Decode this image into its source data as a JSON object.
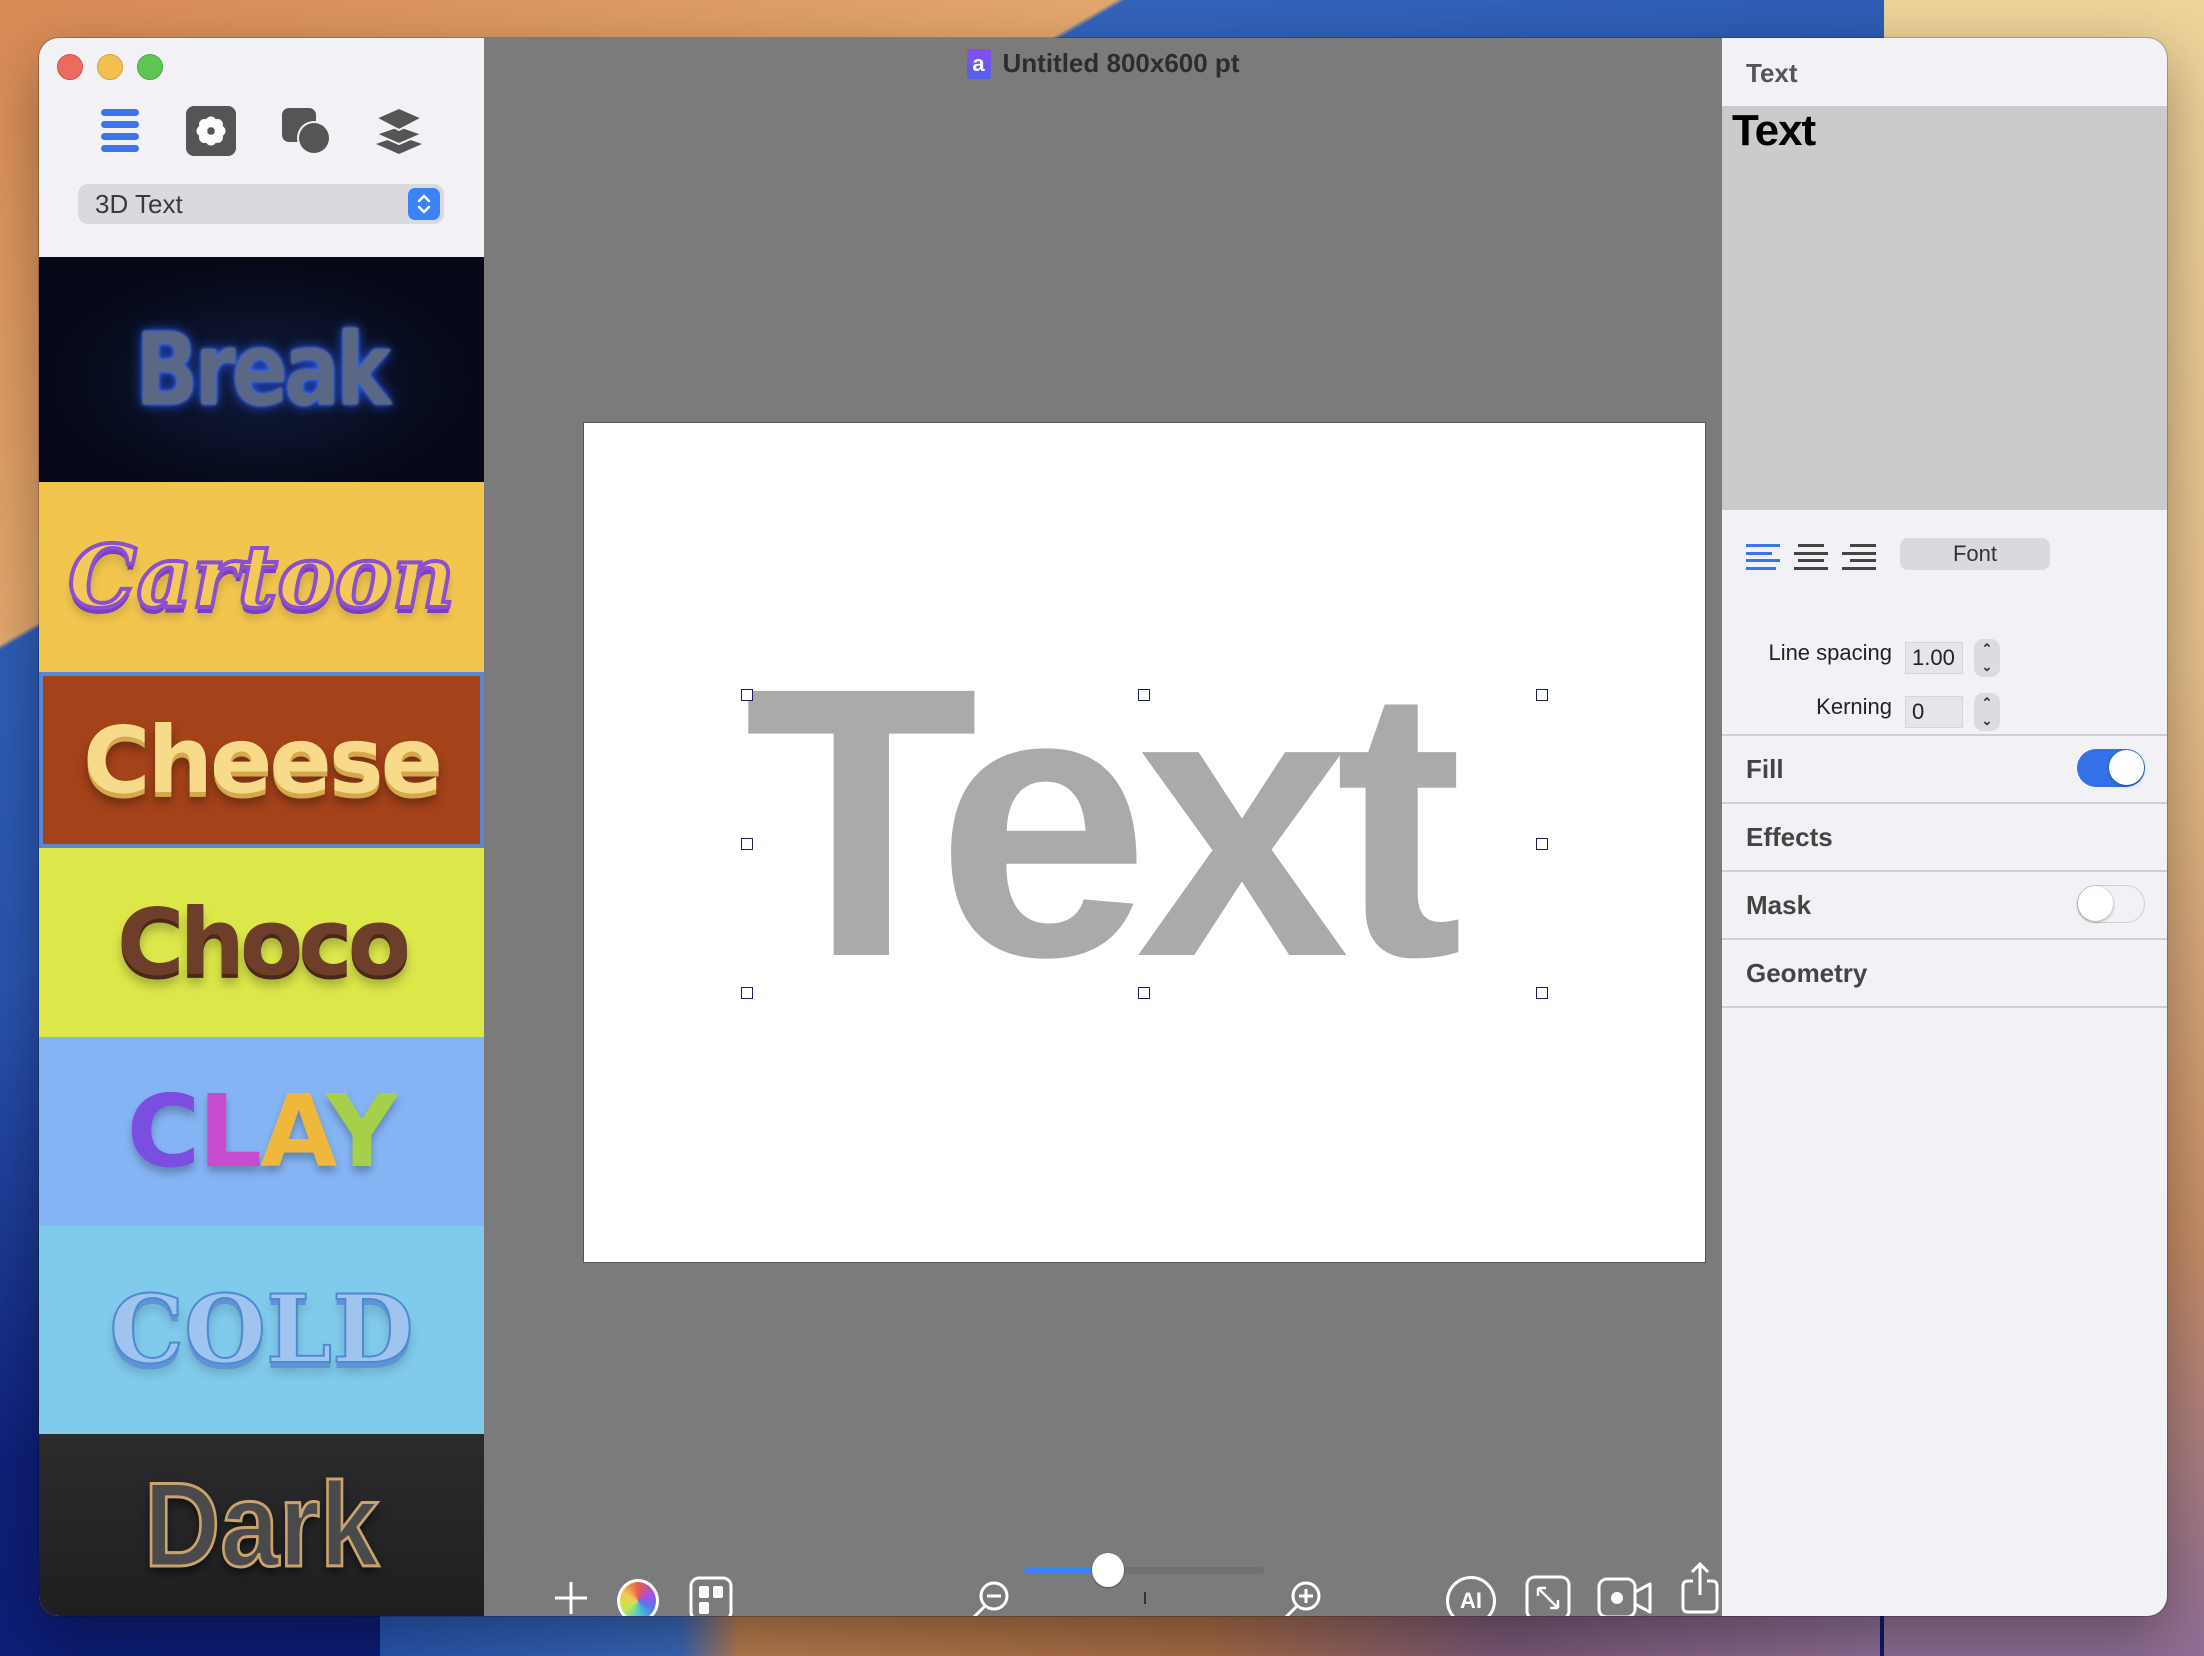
{
  "window": {
    "title": "Untitled 800x600 pt",
    "doc_icon_letter": "a"
  },
  "sidebar": {
    "tools": [
      {
        "name": "list",
        "icon": "list-icon",
        "active": true
      },
      {
        "name": "effects",
        "icon": "flower-gear-icon",
        "active": false
      },
      {
        "name": "shapes",
        "icon": "shapes-icon",
        "active": false
      },
      {
        "name": "layers",
        "icon": "layers-icon",
        "active": false
      }
    ],
    "category_select": {
      "value": "3D Text"
    },
    "styles": [
      {
        "label": "Break",
        "background": "#050816",
        "selected": false
      },
      {
        "label": "Cartoon",
        "background": "#f2c64e",
        "selected": false
      },
      {
        "label": "Cheese",
        "background": "#a4421a",
        "selected": true
      },
      {
        "label": "Choco",
        "background": "#dce74a",
        "selected": false
      },
      {
        "label": "CLAY",
        "background": "#85b4f4",
        "selected": false,
        "letter_colors": [
          "#7a4fe0",
          "#c94bd0",
          "#f0b83a",
          "#a6cf4a"
        ]
      },
      {
        "label": "COLD",
        "background": "#80caec",
        "selected": false
      },
      {
        "label": "Dark",
        "background": "#262628",
        "selected": false
      }
    ]
  },
  "canvas": {
    "text": "Text",
    "text_color": "#aaaaaa",
    "selected": true
  },
  "bottom_toolbar": {
    "add": "plus-icon",
    "color": "color-wheel-icon",
    "templates": "grid-icon",
    "zoom_out": "zoom-out-icon",
    "zoom_in": "zoom-in-icon",
    "zoom_level_fraction": 0.35,
    "ai_label": "AI",
    "resize": "resize-icon",
    "record": "video-camera-icon",
    "share": "share-icon"
  },
  "inspector": {
    "title": "Text",
    "preview_text": "Text",
    "alignment": {
      "options": [
        "left",
        "center",
        "right"
      ],
      "selected": "left"
    },
    "font_button": "Font",
    "line_spacing": {
      "label": "Line spacing",
      "value": "1.00"
    },
    "kerning": {
      "label": "Kerning",
      "value": "0"
    },
    "sections": [
      {
        "label": "Fill",
        "toggle": true,
        "on": true
      },
      {
        "label": "Effects",
        "toggle": false
      },
      {
        "label": "Mask",
        "toggle": true,
        "on": false
      },
      {
        "label": "Geometry",
        "toggle": false
      }
    ],
    "accent_color": "#3471e6"
  }
}
